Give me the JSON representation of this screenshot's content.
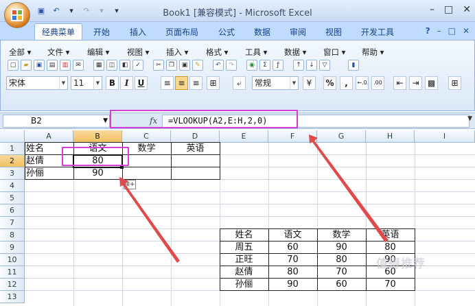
{
  "title": {
    "text": "Book1  [兼容模式] - Microsoft Excel",
    "min": "–",
    "max": "□",
    "close": "✕"
  },
  "qat": {
    "save": "▣",
    "undo": "↶",
    "redo": "↷",
    "more": "▾"
  },
  "tabs": [
    {
      "label": "经典菜单",
      "active": true
    },
    {
      "label": "开始"
    },
    {
      "label": "插入"
    },
    {
      "label": "页面布局"
    },
    {
      "label": "公式"
    },
    {
      "label": "数据"
    },
    {
      "label": "审阅"
    },
    {
      "label": "视图"
    },
    {
      "label": "开发工具"
    }
  ],
  "ribbon_right": {
    "help": "?",
    "min": "–",
    "restore": "□",
    "close": "✕"
  },
  "menu": [
    {
      "label": "全部 ▾"
    },
    {
      "label": "文件 ▾"
    },
    {
      "label": "编辑 ▾"
    },
    {
      "label": "视图 ▾"
    },
    {
      "label": "插入 ▾"
    },
    {
      "label": "格式 ▾"
    },
    {
      "label": "工具 ▾"
    },
    {
      "label": "数据 ▾"
    },
    {
      "label": "窗口 ▾"
    },
    {
      "label": "帮助 ▾"
    }
  ],
  "format": {
    "font": "宋体",
    "size": "11",
    "bold": "B",
    "italic": "I",
    "underline": "U",
    "number_format": "常规",
    "percent": "%",
    "comma": ",",
    "inc_decimal": "←.0",
    "dec_decimal": ".00"
  },
  "formula_bar": {
    "name_box": "B2",
    "fx": "fx",
    "formula": "=VLOOKUP(A2,E:H,2,0)"
  },
  "columns": [
    "A",
    "B",
    "C",
    "D",
    "E",
    "F",
    "G",
    "H",
    "I"
  ],
  "rows": [
    "1",
    "2",
    "3",
    "4",
    "5",
    "6",
    "7",
    "8",
    "9",
    "10",
    "11",
    "12",
    "13"
  ],
  "active_cell": "B2",
  "table1": {
    "headers": [
      "姓名",
      "语文",
      "数学",
      "英语"
    ],
    "rows": [
      [
        "赵倩",
        "80"
      ],
      [
        "孙俪",
        "90"
      ]
    ]
  },
  "table2": {
    "headers": [
      "姓名",
      "语文",
      "数学",
      "英语"
    ],
    "rows": [
      [
        "周五",
        "60",
        "90",
        "80"
      ],
      [
        "正旺",
        "70",
        "80",
        "90"
      ],
      [
        "赵倩",
        "80",
        "70",
        "60"
      ],
      [
        "孙俪",
        "90",
        "60",
        "70"
      ]
    ]
  },
  "watermark": "值得推荐",
  "colors": {
    "highlight": "#d63fd6",
    "arrow": "#e04a4a"
  }
}
